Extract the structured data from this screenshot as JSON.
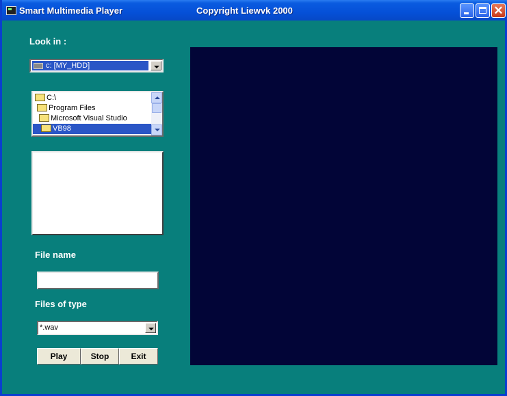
{
  "window": {
    "title": "Smart Multimedia Player",
    "copyright": "Copyright Liewvk  2000",
    "controls": {
      "minimize": "minimize",
      "maximize": "maximize",
      "close": "✕"
    }
  },
  "look_in": {
    "label": "Look in :",
    "drive": "c: [MY_HDD]"
  },
  "directories": [
    {
      "name": "C:\\",
      "selected": false
    },
    {
      "name": "Program Files",
      "selected": false
    },
    {
      "name": "Microsoft Visual Studio",
      "selected": false
    },
    {
      "name": "VB98",
      "selected": true
    }
  ],
  "file_name": {
    "label": "File name",
    "value": ""
  },
  "files_of_type": {
    "label": "Files of type",
    "value": "*.wav"
  },
  "buttons": {
    "play": "Play",
    "stop": "Stop",
    "exit": "Exit"
  },
  "colors": {
    "background": "#087f7c",
    "display": "#020537",
    "title_bar": "#0550d8",
    "selection": "#2a56c6"
  }
}
